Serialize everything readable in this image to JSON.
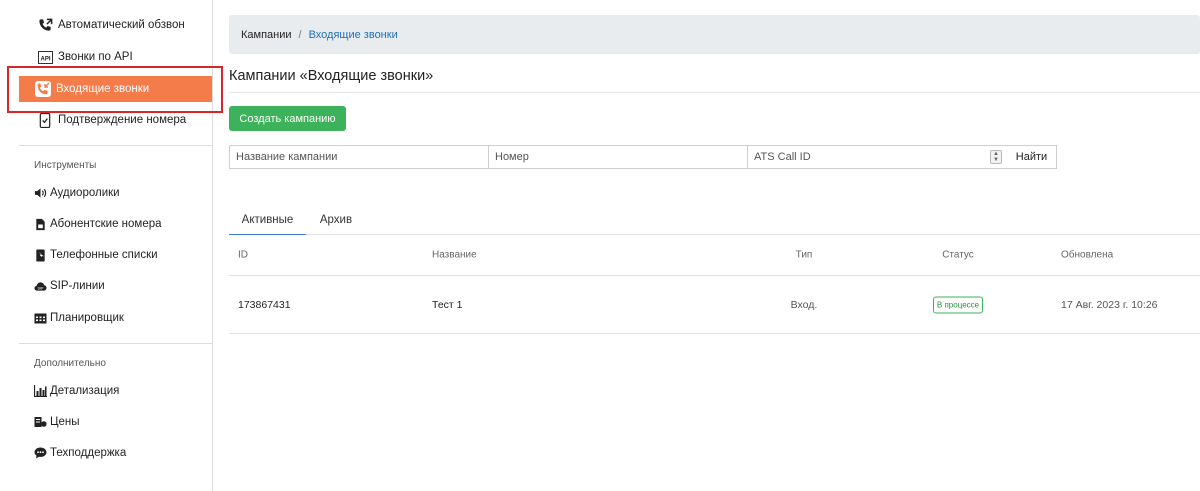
{
  "sidebar": {
    "items_top": [
      {
        "label": "Автоматический обзвон",
        "icon": "phone-forward-icon"
      },
      {
        "label": "Звонки по API",
        "icon": "api-icon"
      },
      {
        "label": "Входящие звонки",
        "icon": "phone-incoming-icon",
        "active": true
      },
      {
        "label": "Подтверждение номера",
        "icon": "phone-check-icon"
      }
    ],
    "section_tools": "Инструменты",
    "tools": [
      {
        "label": "Аудиоролики",
        "icon": "speaker-icon"
      },
      {
        "label": "Абонентские номера",
        "icon": "sim-card-icon"
      },
      {
        "label": "Телефонные списки",
        "icon": "contact-book-icon"
      },
      {
        "label": "SIP-линии",
        "icon": "cloud-phone-icon"
      },
      {
        "label": "Планировщик",
        "icon": "calendar-icon"
      }
    ],
    "section_extra": "Дополнительно",
    "extra": [
      {
        "label": "Детализация",
        "icon": "bar-chart-icon"
      },
      {
        "label": "Цены",
        "icon": "price-icon"
      },
      {
        "label": "Техподдержка",
        "icon": "chat-icon"
      }
    ]
  },
  "breadcrumb": {
    "root": "Кампании",
    "separator": "/",
    "current": "Входящие звонки"
  },
  "page_title": "Кампании «Входящие звонки»",
  "create_button": "Создать кампанию",
  "search": {
    "name_placeholder": "Название кампании",
    "number_placeholder": "Номер",
    "ats_placeholder": "ATS Call ID",
    "find_button": "Найти"
  },
  "tabs": {
    "active": "Активные",
    "archive": "Архив"
  },
  "table": {
    "headers": {
      "id": "ID",
      "name": "Название",
      "type": "Тип",
      "status": "Статус",
      "updated": "Обновлена"
    },
    "rows": [
      {
        "id": "173867431",
        "name": "Тест 1",
        "type": "Вход.",
        "status": "В процессе",
        "updated": "17 Авг. 2023 г. 10:26"
      }
    ]
  },
  "colors": {
    "accent": "#f47c4b",
    "success": "#3cb35a",
    "link": "#1e6fb8",
    "highlight": "#d9262b"
  }
}
